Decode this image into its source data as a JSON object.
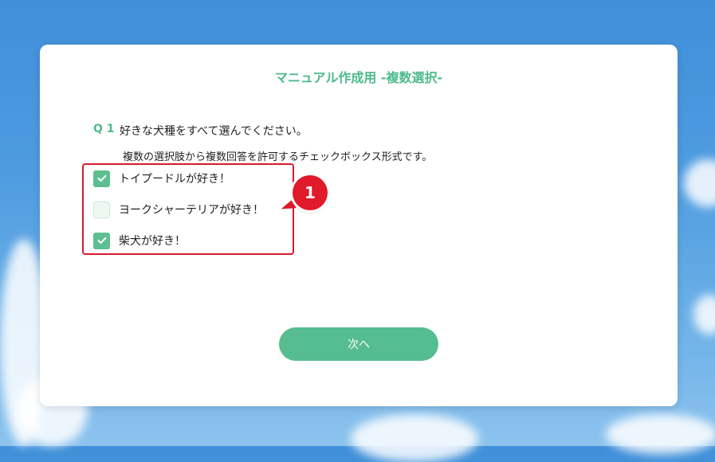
{
  "page": {
    "title": "マニュアル作成用 -複数選択-",
    "question_number": "Q 1",
    "question_text": "好きな犬種をすべて選んでください。",
    "question_sub": "複数の選択肢から複数回答を許可するチェックボックス形式です。"
  },
  "options": [
    {
      "label": "トイプードルが好き！",
      "checked": true
    },
    {
      "label": "ヨークシャーテリアが好き！",
      "checked": false
    },
    {
      "label": "柴犬が好き！",
      "checked": true
    }
  ],
  "annotation": {
    "number": "1",
    "color": "#e0192b"
  },
  "buttons": {
    "next_label": "次へ"
  },
  "colors": {
    "accent": "#4dba8c",
    "button": "#55bd8f",
    "checkbox": "#5dbf90"
  },
  "icons": {
    "check": "check-icon"
  }
}
